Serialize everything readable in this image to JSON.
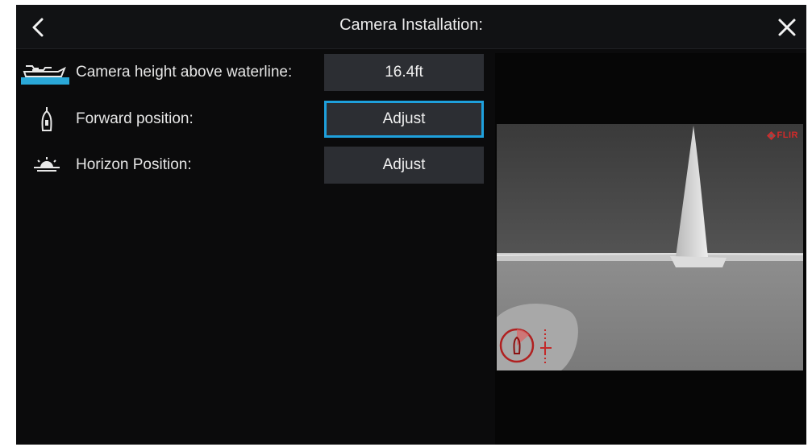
{
  "header": {
    "title": "Camera Installation:",
    "back_icon": "chevron-left-icon",
    "close_icon": "close-icon"
  },
  "settings": [
    {
      "icon": "boat-waterline-icon",
      "label": "Camera height above waterline:",
      "value": "16.4ft",
      "focused": false
    },
    {
      "icon": "boat-forward-icon",
      "label": "Forward position:",
      "value": "Adjust",
      "focused": true
    },
    {
      "icon": "horizon-sun-icon",
      "label": "Horizon Position:",
      "value": "Adjust",
      "focused": false
    }
  ],
  "camera": {
    "brand": "FLIR"
  },
  "colors": {
    "background": "#0b0b0c",
    "button": "#2c2e33",
    "focus": "#1ea0dc",
    "waterline": "#2aa8d8",
    "brand": "#d22a2a"
  }
}
